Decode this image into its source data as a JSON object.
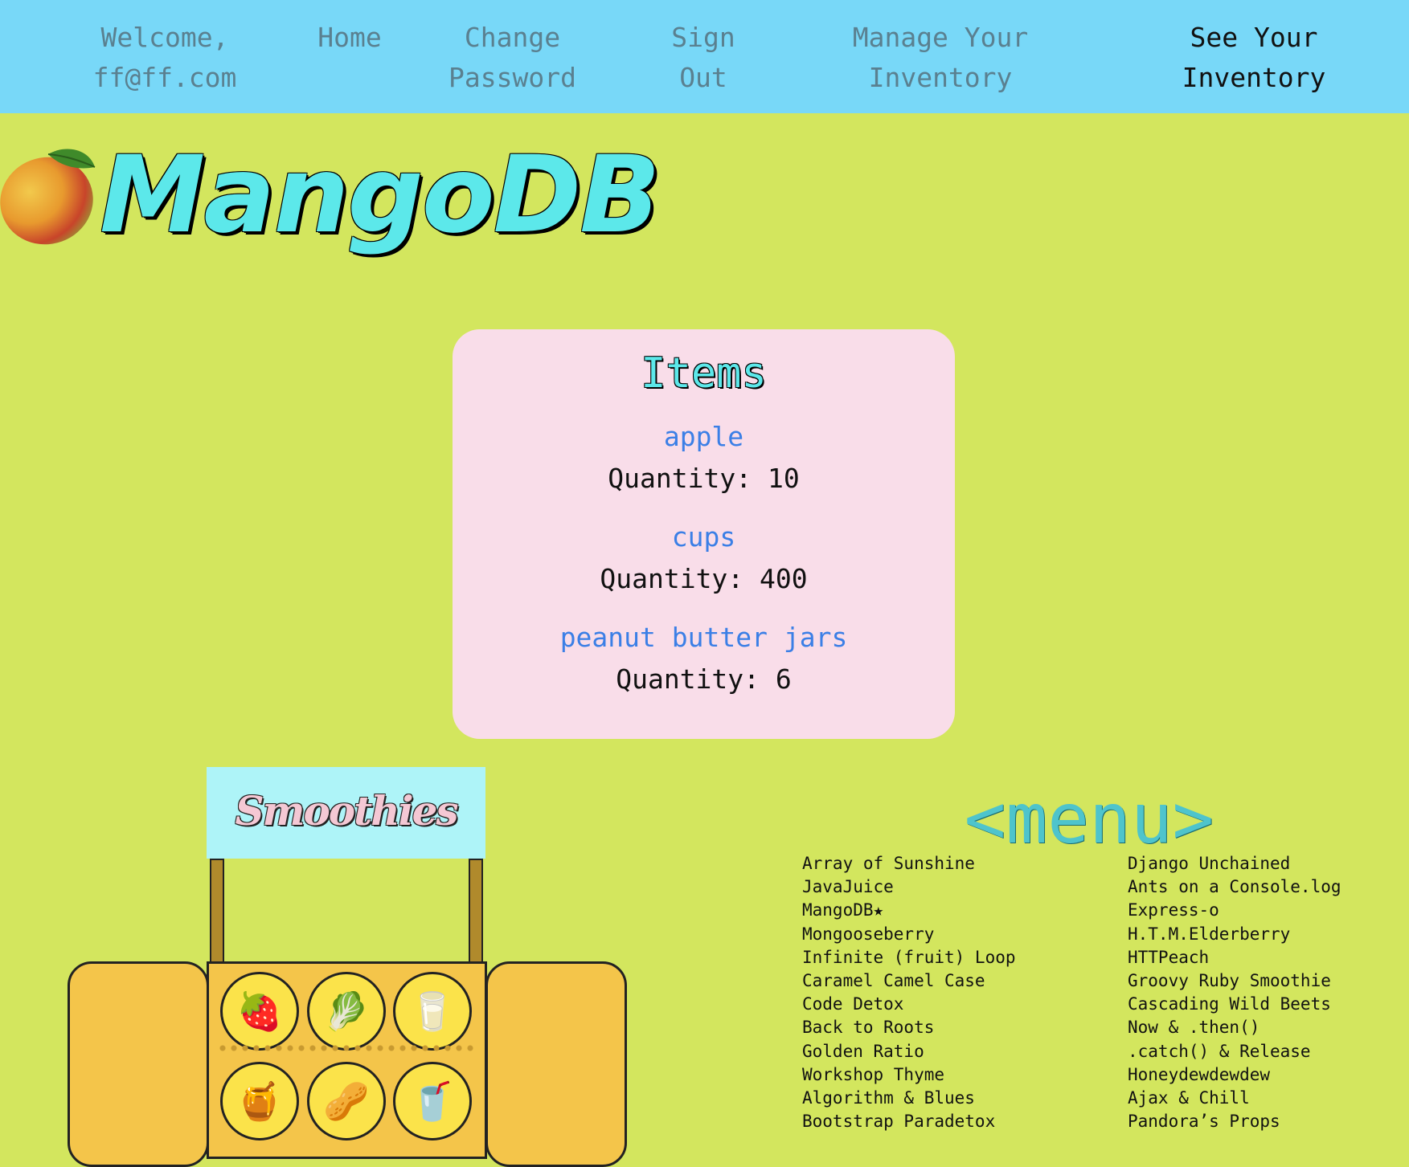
{
  "nav": {
    "welcome": "Welcome,\nff@ff.com",
    "home": "Home",
    "change_password": "Change\nPassword",
    "sign_out": "Sign\nOut",
    "manage_inventory": "Manage Your\nInventory",
    "see_inventory": "See Your\nInventory"
  },
  "logo": {
    "text": "MangoDB",
    "icon": "mango-icon"
  },
  "items_card": {
    "title": "Items",
    "items": [
      {
        "name": "apple",
        "quantity": "Quantity: 10"
      },
      {
        "name": "cups",
        "quantity": "Quantity: 400"
      },
      {
        "name": "peanut butter jars",
        "quantity": "Quantity: 6"
      }
    ]
  },
  "stand": {
    "sign_text": "Smoothies",
    "icons": [
      "strawberry-icon",
      "leafy-greens-icon",
      "milk-glass-icon",
      "honey-pot-icon",
      "peanuts-icon",
      "cup-with-straw-icon"
    ]
  },
  "menu": {
    "title": "<menu>",
    "left": [
      "Array of Sunshine",
      "JavaJuice",
      "MangoDB★",
      "Mongooseberry",
      "Infinite (fruit) Loop",
      "Caramel Camel Case",
      "Code Detox",
      "Back to Roots",
      "Golden Ratio",
      "Workshop Thyme",
      "Algorithm & Blues",
      "Bootstrap Paradetox"
    ],
    "right": [
      "Django Unchained",
      "Ants on a Console.log",
      "Express-o",
      "H.T.M.Elderberry",
      "HTTPeach",
      "Groovy Ruby Smoothie",
      "Cascading Wild Beets",
      "Now & .then()",
      ".catch() & Release",
      "Honeydewdewdew",
      "Ajax & Chill",
      "Pandora’s Props"
    ]
  },
  "colors": {
    "background": "#d3e65e",
    "nav": "#78d8f8",
    "card": "#f9dde9",
    "item_link": "#3b7fe6",
    "logo": "#5ce8ea"
  }
}
